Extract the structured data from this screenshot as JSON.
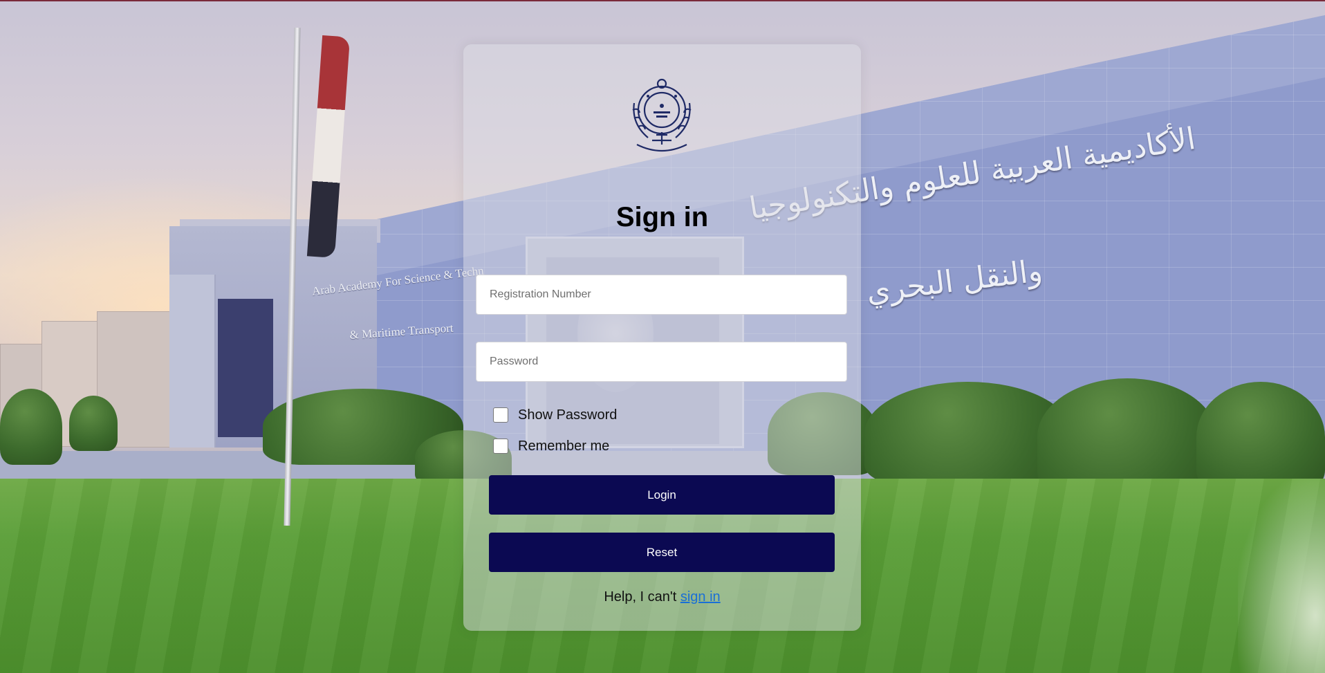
{
  "background": {
    "facade_text_en_line1": "Arab Academy For Science & Techn",
    "facade_text_en_line2": "& Maritime Transport",
    "facade_text_ar_line1": "الأكاديمية العربية للعلوم والتكنولوجيا",
    "facade_text_ar_line2": "والنقل البحري"
  },
  "login": {
    "logo_icon": "academy-seal-logo",
    "title": "Sign in",
    "registration_placeholder": "Registration Number",
    "registration_value": "",
    "password_placeholder": "Password",
    "password_value": "",
    "show_password_label": "Show Password",
    "show_password_checked": false,
    "remember_me_label": "Remember me",
    "remember_me_checked": false,
    "login_button": "Login",
    "reset_button": "Reset",
    "help_text": "Help, I can't",
    "help_link": "sign in"
  },
  "colors": {
    "button_bg": "#0b0952",
    "link": "#1a6fd6",
    "card_bg": "rgba(220,220,228,0.5)"
  }
}
